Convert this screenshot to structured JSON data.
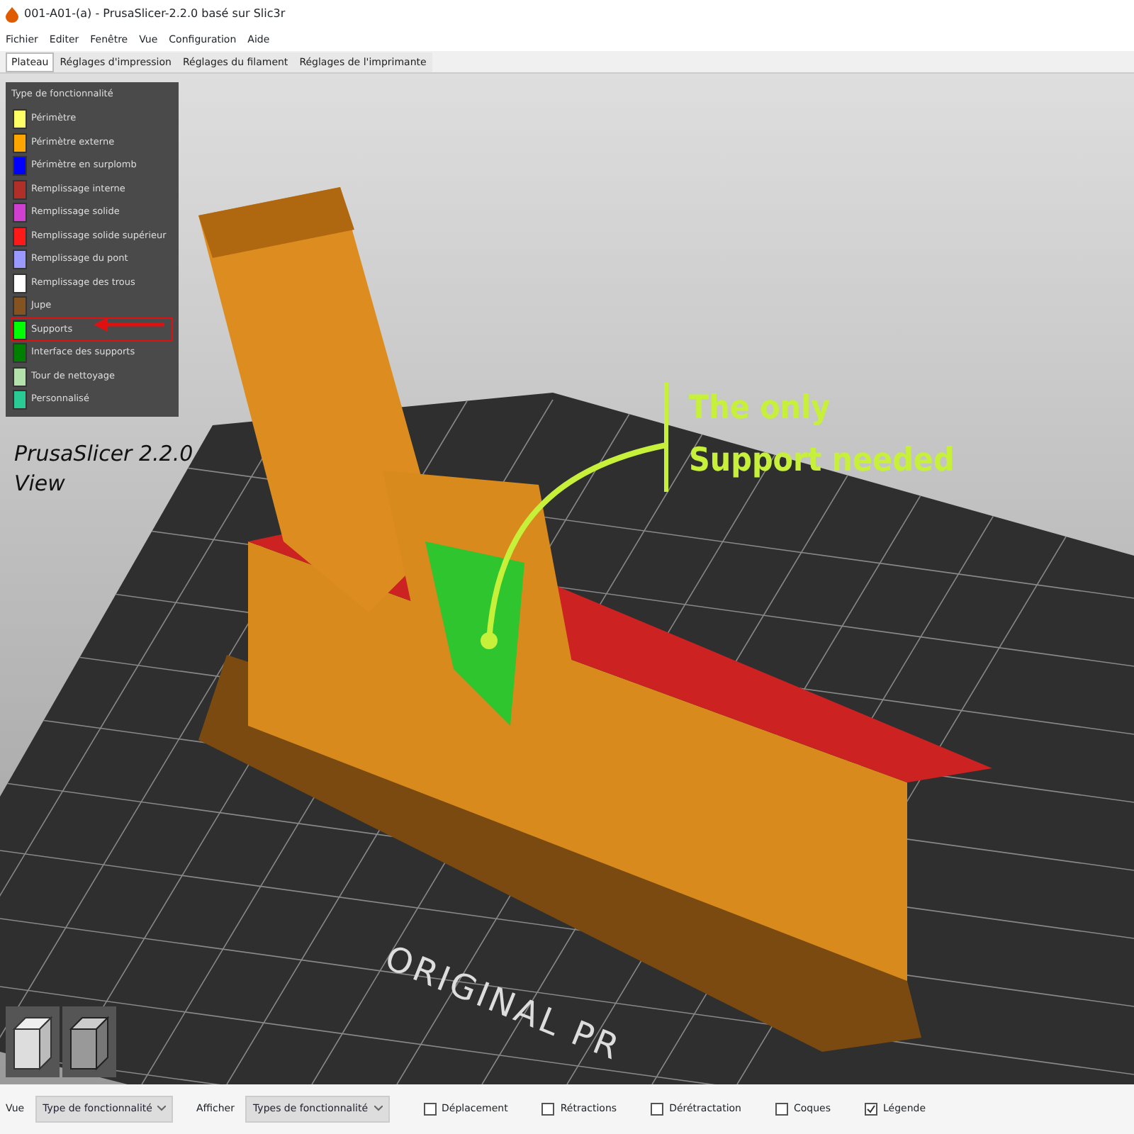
{
  "window": {
    "title": "001-A01-(a) - PrusaSlicer-2.2.0 basé sur Slic3r"
  },
  "menu": [
    "Fichier",
    "Editer",
    "Fenêtre",
    "Vue",
    "Configuration",
    "Aide"
  ],
  "tabs": [
    {
      "label": "Plateau",
      "selected": true
    },
    {
      "label": "Réglages d'impression",
      "selected": false
    },
    {
      "label": "Réglages du filament",
      "selected": false
    },
    {
      "label": "Réglages de l'imprimante",
      "selected": false
    }
  ],
  "legend": {
    "title": "Type de fonctionnalité",
    "items": [
      {
        "label": "Périmètre",
        "color": "#ffff66",
        "highlighted": false
      },
      {
        "label": "Périmètre externe",
        "color": "#ffa500",
        "highlighted": false
      },
      {
        "label": "Périmètre en surplomb",
        "color": "#0000ff",
        "highlighted": false
      },
      {
        "label": "Remplissage interne",
        "color": "#b03029",
        "highlighted": false
      },
      {
        "label": "Remplissage solide",
        "color": "#d040d0",
        "highlighted": false
      },
      {
        "label": "Remplissage solide supérieur",
        "color": "#ff1a1a",
        "highlighted": false
      },
      {
        "label": "Remplissage du pont",
        "color": "#9999ff",
        "highlighted": false
      },
      {
        "label": "Remplissage des trous",
        "color": "#ffffff",
        "highlighted": false
      },
      {
        "label": "Jupe",
        "color": "#845321",
        "highlighted": false
      },
      {
        "label": "Supports",
        "color": "#00ff00",
        "highlighted": true
      },
      {
        "label": "Interface des supports",
        "color": "#008000",
        "highlighted": false
      },
      {
        "label": "Tour de nettoyage",
        "color": "#b3e3ab",
        "highlighted": false
      },
      {
        "label": "Personnalisé",
        "color": "#28cc94",
        "highlighted": false
      }
    ]
  },
  "viewport": {
    "caption": [
      "PrusaSlicer 2.2.0",
      "View"
    ],
    "annotation": [
      "The only",
      "Support needed"
    ],
    "bed_label": "ORIGINAL PR"
  },
  "bottom_bar": {
    "view_label": "Vue",
    "view_select": "Type de fonctionnalité",
    "show_label": "Afficher",
    "show_select": "Types de fonctionnalité",
    "checkboxes": [
      {
        "label": "Déplacement",
        "checked": false
      },
      {
        "label": "Rétractions",
        "checked": false
      },
      {
        "label": "Dérétractation",
        "checked": false
      },
      {
        "label": "Coques",
        "checked": false
      },
      {
        "label": "Légende",
        "checked": true
      }
    ]
  }
}
